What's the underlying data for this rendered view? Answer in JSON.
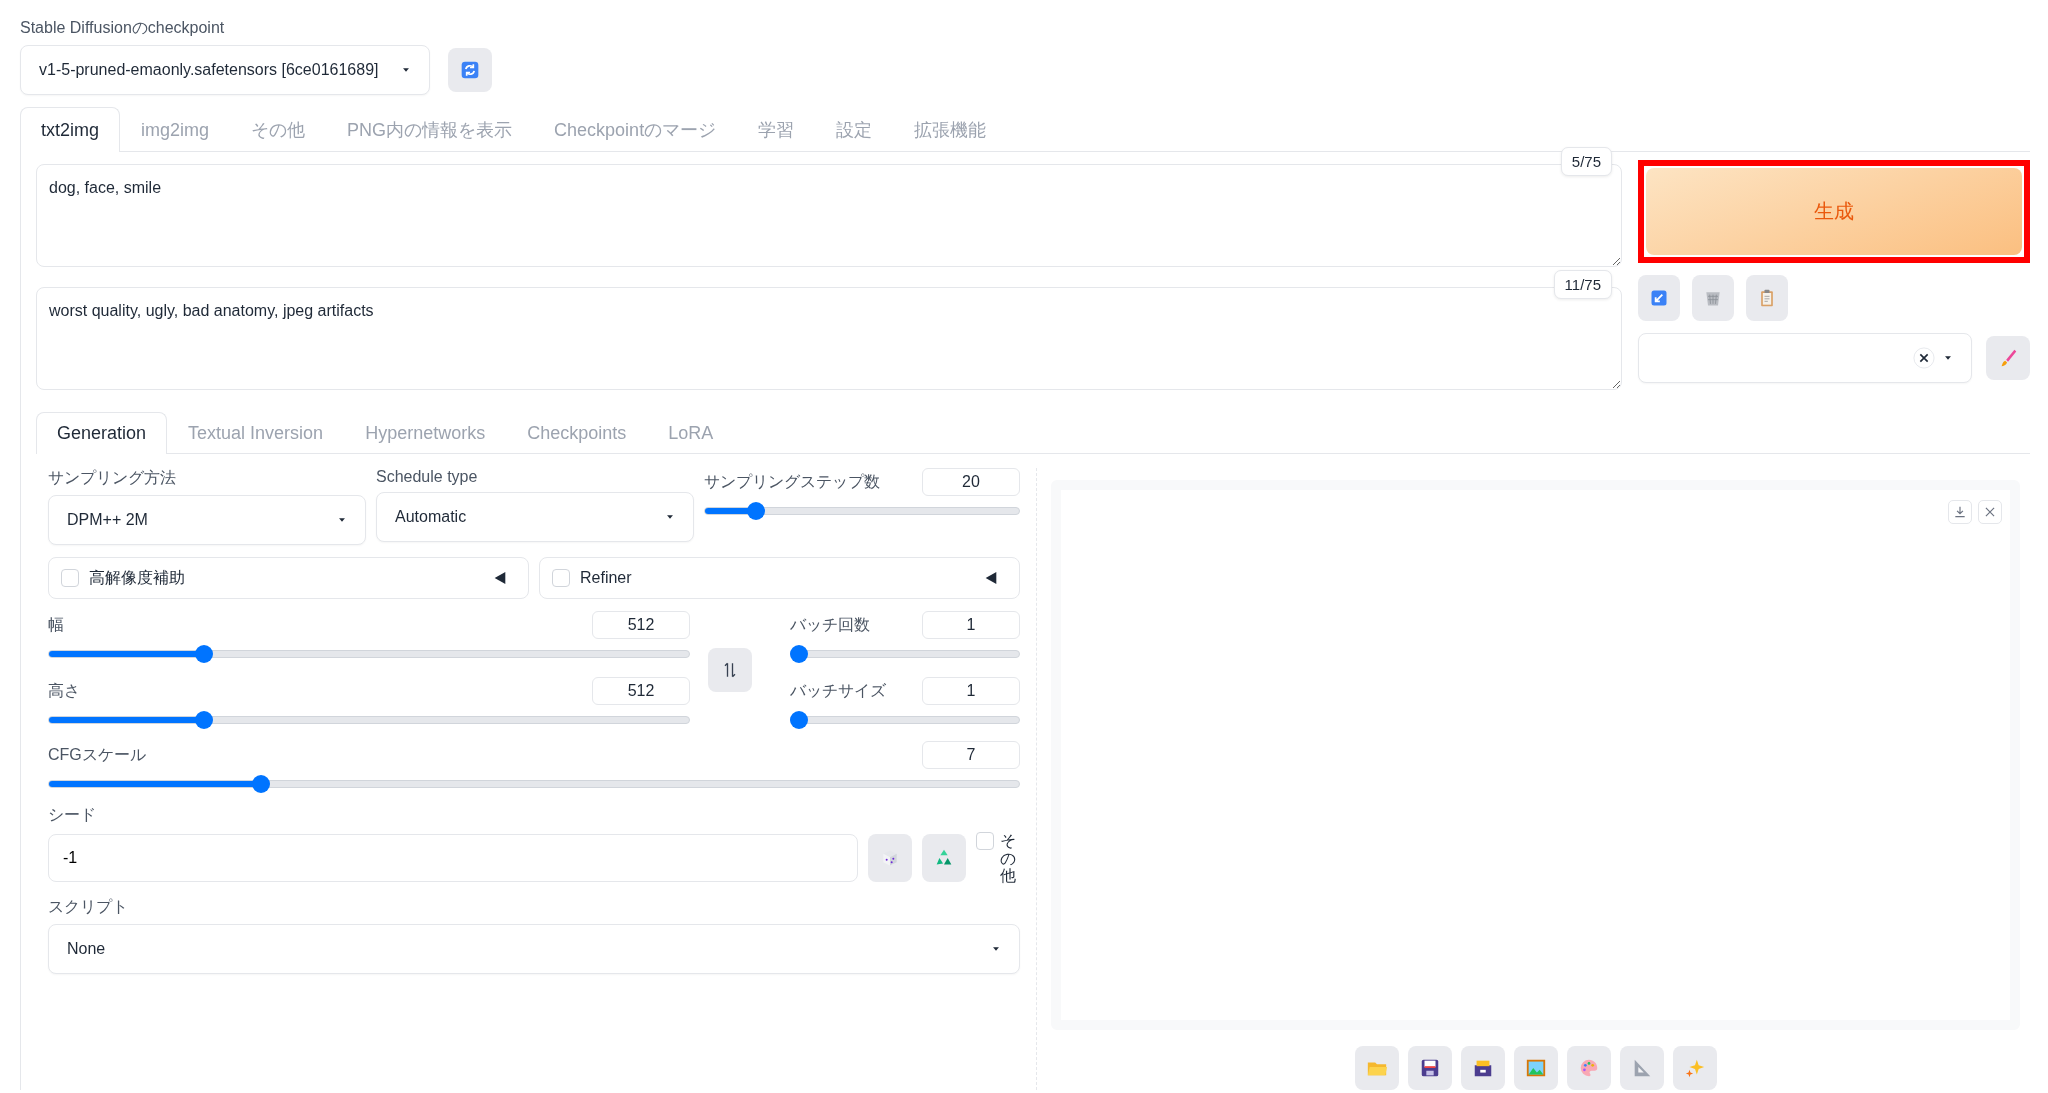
{
  "checkpoint": {
    "label": "Stable Diffusionのcheckpoint",
    "value": "v1-5-pruned-emaonly.safetensors [6ce0161689]"
  },
  "tabs": [
    {
      "label": "txt2img",
      "selected": true
    },
    {
      "label": "img2img",
      "selected": false
    },
    {
      "label": "その他",
      "selected": false
    },
    {
      "label": "PNG内の情報を表示",
      "selected": false
    },
    {
      "label": "Checkpointのマージ",
      "selected": false
    },
    {
      "label": "学習",
      "selected": false
    },
    {
      "label": "設定",
      "selected": false
    },
    {
      "label": "拡張機能",
      "selected": false
    }
  ],
  "prompt": {
    "value": "dog, face, smile",
    "token_count": "5/75"
  },
  "negative_prompt": {
    "value": "worst quality, ugly, bad anatomy, jpeg artifacts",
    "token_count": "11/75"
  },
  "generate_button": {
    "label": "生成",
    "highlighted": true
  },
  "subtabs": [
    {
      "label": "Generation",
      "selected": true
    },
    {
      "label": "Textual Inversion",
      "selected": false
    },
    {
      "label": "Hypernetworks",
      "selected": false
    },
    {
      "label": "Checkpoints",
      "selected": false
    },
    {
      "label": "LoRA",
      "selected": false
    }
  ],
  "sampler": {
    "label": "サンプリング方法",
    "value": "DPM++ 2M"
  },
  "schedule": {
    "label": "Schedule type",
    "value": "Automatic"
  },
  "steps": {
    "label": "サンプリングステップ数",
    "value": "20",
    "level": 0.145
  },
  "accordions": [
    {
      "label": "高解像度補助",
      "checked": false
    },
    {
      "label": "Refiner",
      "checked": false
    }
  ],
  "width": {
    "label": "幅",
    "value": "512",
    "level": 0.236
  },
  "height": {
    "label": "高さ",
    "value": "512",
    "level": 0.236
  },
  "batch_count": {
    "label": "バッチ回数",
    "value": "1",
    "level": 0
  },
  "batch_size": {
    "label": "バッチサイズ",
    "value": "1",
    "level": 0
  },
  "cfg": {
    "label": "CFGスケール",
    "value": "7",
    "level": 0.214
  },
  "seed": {
    "label": "シード",
    "value": "-1"
  },
  "extra": {
    "label": "その他",
    "checked": false
  },
  "script": {
    "label": "スクリプト",
    "value": "None"
  }
}
